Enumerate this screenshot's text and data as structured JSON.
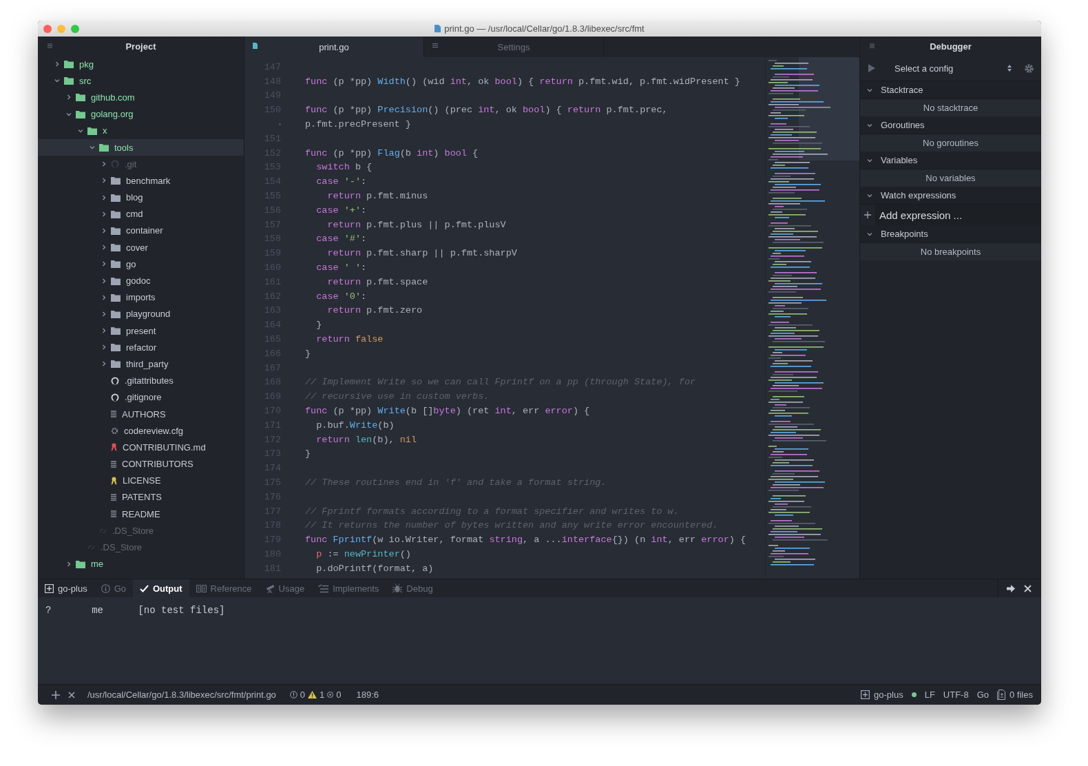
{
  "window": {
    "title": "print.go — /usr/local/Cellar/go/1.8.3/libexec/src/fmt"
  },
  "project": {
    "title": "Project",
    "tree": [
      {
        "name": "pkg",
        "kind": "folder",
        "color": "#73c990",
        "expanded": false,
        "selected": false,
        "dimmed": false
      },
      {
        "name": "src",
        "kind": "folder",
        "color": "#73c990",
        "expanded": true,
        "selected": false,
        "dimmed": false,
        "children": [
          {
            "name": "github.com",
            "kind": "folder",
            "color": "#73c990",
            "expanded": false,
            "selected": false,
            "dimmed": false
          },
          {
            "name": "golang.org",
            "kind": "folder",
            "color": "#73c990",
            "expanded": true,
            "selected": false,
            "dimmed": false,
            "children": [
              {
                "name": "x",
                "kind": "folder",
                "color": "#73c990",
                "expanded": true,
                "selected": false,
                "dimmed": false,
                "children": [
                  {
                    "name": "tools",
                    "kind": "folder",
                    "color": "#73c990",
                    "expanded": true,
                    "selected": true,
                    "dimmed": false,
                    "children": [
                      {
                        "name": ".git",
                        "kind": "repo",
                        "expanded": false,
                        "selected": false,
                        "dimmed": true
                      },
                      {
                        "name": "benchmark",
                        "kind": "folder",
                        "color": "#9da5b4",
                        "expanded": false,
                        "selected": false,
                        "dimmed": false
                      },
                      {
                        "name": "blog",
                        "kind": "folder",
                        "color": "#9da5b4",
                        "expanded": false,
                        "selected": false,
                        "dimmed": false
                      },
                      {
                        "name": "cmd",
                        "kind": "folder",
                        "color": "#9da5b4",
                        "expanded": false,
                        "selected": false,
                        "dimmed": false
                      },
                      {
                        "name": "container",
                        "kind": "folder",
                        "color": "#9da5b4",
                        "expanded": false,
                        "selected": false,
                        "dimmed": false
                      },
                      {
                        "name": "cover",
                        "kind": "folder",
                        "color": "#9da5b4",
                        "expanded": false,
                        "selected": false,
                        "dimmed": false
                      },
                      {
                        "name": "go",
                        "kind": "folder",
                        "color": "#9da5b4",
                        "expanded": false,
                        "selected": false,
                        "dimmed": false
                      },
                      {
                        "name": "godoc",
                        "kind": "folder",
                        "color": "#9da5b4",
                        "expanded": false,
                        "selected": false,
                        "dimmed": false
                      },
                      {
                        "name": "imports",
                        "kind": "folder",
                        "color": "#9da5b4",
                        "expanded": false,
                        "selected": false,
                        "dimmed": false
                      },
                      {
                        "name": "playground",
                        "kind": "folder",
                        "color": "#9da5b4",
                        "expanded": false,
                        "selected": false,
                        "dimmed": false
                      },
                      {
                        "name": "present",
                        "kind": "folder",
                        "color": "#9da5b4",
                        "expanded": false,
                        "selected": false,
                        "dimmed": false
                      },
                      {
                        "name": "refactor",
                        "kind": "folder",
                        "color": "#9da5b4",
                        "expanded": false,
                        "selected": false,
                        "dimmed": false
                      },
                      {
                        "name": "third_party",
                        "kind": "folder",
                        "color": "#9da5b4",
                        "expanded": false,
                        "selected": false,
                        "dimmed": false
                      },
                      {
                        "name": ".gitattributes",
                        "kind": "git",
                        "selected": false,
                        "dimmed": false
                      },
                      {
                        "name": ".gitignore",
                        "kind": "git",
                        "selected": false,
                        "dimmed": false
                      },
                      {
                        "name": "AUTHORS",
                        "kind": "text",
                        "selected": false,
                        "dimmed": false
                      },
                      {
                        "name": "codereview.cfg",
                        "kind": "config",
                        "selected": false,
                        "dimmed": false
                      },
                      {
                        "name": "CONTRIBUTING.md",
                        "kind": "markdown",
                        "selected": false,
                        "dimmed": false
                      },
                      {
                        "name": "CONTRIBUTORS",
                        "kind": "text",
                        "selected": false,
                        "dimmed": false
                      },
                      {
                        "name": "LICENSE",
                        "kind": "license",
                        "selected": false,
                        "dimmed": false
                      },
                      {
                        "name": "PATENTS",
                        "kind": "text",
                        "selected": false,
                        "dimmed": false
                      },
                      {
                        "name": "README",
                        "kind": "text",
                        "selected": false,
                        "dimmed": false
                      }
                    ]
                  },
                  {
                    "name": ".DS_Store",
                    "kind": "link",
                    "selected": false,
                    "dimmed": true
                  }
                ]
              },
              {
                "name": ".DS_Store",
                "kind": "link",
                "selected": false,
                "dimmed": true
              }
            ]
          },
          {
            "name": "me",
            "kind": "folder",
            "color": "#73c990",
            "expanded": false,
            "selected": false,
            "dimmed": false
          }
        ]
      }
    ]
  },
  "editor": {
    "tabs": [
      {
        "label": "print.go",
        "kind": "file",
        "selected": true
      },
      {
        "label": "Settings",
        "kind": "settings",
        "selected": false
      }
    ],
    "lines": [
      {
        "number": "147"
      },
      {
        "number": "148",
        "tokens": [
          {
            "kind": "kw",
            "text": "func"
          },
          {
            "kind": "plain",
            "text": " (p *pp) "
          },
          {
            "kind": "fn",
            "text": "Width"
          },
          {
            "kind": "plain",
            "text": "() (wid "
          },
          {
            "kind": "type",
            "text": "int"
          },
          {
            "kind": "plain",
            "text": ", ok "
          },
          {
            "kind": "type",
            "text": "bool"
          },
          {
            "kind": "plain",
            "text": ") { "
          },
          {
            "kind": "kw",
            "text": "return"
          },
          {
            "kind": "plain",
            "text": " p.fmt.wid, p.fmt.widPresent }"
          }
        ]
      },
      {
        "number": "149"
      },
      {
        "number": "150",
        "tokens": [
          {
            "kind": "kw",
            "text": "func"
          },
          {
            "kind": "plain",
            "text": " (p *pp) "
          },
          {
            "kind": "fn",
            "text": "Precision"
          },
          {
            "kind": "plain",
            "text": "() (prec "
          },
          {
            "kind": "type",
            "text": "int"
          },
          {
            "kind": "plain",
            "text": ", ok "
          },
          {
            "kind": "type",
            "text": "bool"
          },
          {
            "kind": "plain",
            "text": ") { "
          },
          {
            "kind": "kw",
            "text": "return"
          },
          {
            "kind": "plain",
            "text": " p.fmt.prec,"
          }
        ],
        "wrapped": "p.fmt.precPresent }"
      },
      {
        "number": "151"
      },
      {
        "number": "152",
        "tokens": [
          {
            "kind": "kw",
            "text": "func"
          },
          {
            "kind": "plain",
            "text": " (p *pp) "
          },
          {
            "kind": "fn",
            "text": "Flag"
          },
          {
            "kind": "plain",
            "text": "(b "
          },
          {
            "kind": "type",
            "text": "int"
          },
          {
            "kind": "plain",
            "text": ") "
          },
          {
            "kind": "type",
            "text": "bool"
          },
          {
            "kind": "plain",
            "text": " {"
          }
        ]
      },
      {
        "number": "153",
        "tokens": [
          {
            "kind": "kw",
            "text": "  switch"
          },
          {
            "kind": "plain",
            "text": " b {"
          }
        ]
      },
      {
        "number": "154",
        "tokens": [
          {
            "kind": "kw",
            "text": "  case "
          },
          {
            "kind": "str",
            "text": "'-'"
          },
          {
            "kind": "plain",
            "text": ":"
          }
        ]
      },
      {
        "number": "155",
        "tokens": [
          {
            "kind": "kw",
            "text": "    return"
          },
          {
            "kind": "plain",
            "text": " p.fmt.minus"
          }
        ]
      },
      {
        "number": "156",
        "tokens": [
          {
            "kind": "kw",
            "text": "  case "
          },
          {
            "kind": "str",
            "text": "'+'"
          },
          {
            "kind": "plain",
            "text": ":"
          }
        ]
      },
      {
        "number": "157",
        "tokens": [
          {
            "kind": "kw",
            "text": "    return"
          },
          {
            "kind": "plain",
            "text": " p.fmt.plus || p.fmt.plusV"
          }
        ]
      },
      {
        "number": "158",
        "tokens": [
          {
            "kind": "kw",
            "text": "  case "
          },
          {
            "kind": "str",
            "text": "'#'"
          },
          {
            "kind": "plain",
            "text": ":"
          }
        ]
      },
      {
        "number": "159",
        "tokens": [
          {
            "kind": "kw",
            "text": "    return"
          },
          {
            "kind": "plain",
            "text": " p.fmt.sharp || p.fmt.sharpV"
          }
        ]
      },
      {
        "number": "160",
        "tokens": [
          {
            "kind": "kw",
            "text": "  case "
          },
          {
            "kind": "str",
            "text": "' '"
          },
          {
            "kind": "plain",
            "text": ":"
          }
        ]
      },
      {
        "number": "161",
        "tokens": [
          {
            "kind": "kw",
            "text": "    return"
          },
          {
            "kind": "plain",
            "text": " p.fmt.space"
          }
        ]
      },
      {
        "number": "162",
        "tokens": [
          {
            "kind": "kw",
            "text": "  case "
          },
          {
            "kind": "str",
            "text": "'0'"
          },
          {
            "kind": "plain",
            "text": ":"
          }
        ]
      },
      {
        "number": "163",
        "tokens": [
          {
            "kind": "kw",
            "text": "    return"
          },
          {
            "kind": "plain",
            "text": " p.fmt.zero"
          }
        ]
      },
      {
        "number": "164",
        "tokens": [
          {
            "kind": "plain",
            "text": "  }"
          }
        ]
      },
      {
        "number": "165",
        "tokens": [
          {
            "kind": "kw",
            "text": "  return "
          },
          {
            "kind": "const",
            "text": "false"
          }
        ]
      },
      {
        "number": "166",
        "tokens": [
          {
            "kind": "plain",
            "text": "}"
          }
        ]
      },
      {
        "number": "167"
      },
      {
        "number": "168",
        "tokens": [
          {
            "kind": "com",
            "text": "// Implement Write so we can call Fprintf on a pp (through State), for"
          }
        ]
      },
      {
        "number": "169",
        "tokens": [
          {
            "kind": "com",
            "text": "// recursive use in custom verbs."
          }
        ]
      },
      {
        "number": "170",
        "tokens": [
          {
            "kind": "kw",
            "text": "func"
          },
          {
            "kind": "plain",
            "text": " (p *pp) "
          },
          {
            "kind": "fn",
            "text": "Write"
          },
          {
            "kind": "plain",
            "text": "(b []"
          },
          {
            "kind": "type",
            "text": "byte"
          },
          {
            "kind": "plain",
            "text": ") (ret "
          },
          {
            "kind": "type",
            "text": "int"
          },
          {
            "kind": "plain",
            "text": ", err "
          },
          {
            "kind": "type",
            "text": "error"
          },
          {
            "kind": "plain",
            "text": ") {"
          }
        ]
      },
      {
        "number": "171",
        "tokens": [
          {
            "kind": "plain",
            "text": "  p.buf."
          },
          {
            "kind": "fn",
            "text": "Write"
          },
          {
            "kind": "plain",
            "text": "(b)"
          }
        ]
      },
      {
        "number": "172",
        "tokens": [
          {
            "kind": "kw",
            "text": "  return "
          },
          {
            "kind": "builtin",
            "text": "len"
          },
          {
            "kind": "plain",
            "text": "(b), "
          },
          {
            "kind": "const",
            "text": "nil"
          }
        ]
      },
      {
        "number": "173",
        "tokens": [
          {
            "kind": "plain",
            "text": "}"
          }
        ]
      },
      {
        "number": "174"
      },
      {
        "number": "175",
        "tokens": [
          {
            "kind": "com",
            "text": "// These routines end in 'f' and take a format string."
          }
        ]
      },
      {
        "number": "176"
      },
      {
        "number": "177",
        "tokens": [
          {
            "kind": "com",
            "text": "// Fprintf formats according to a format specifier and writes to w."
          }
        ]
      },
      {
        "number": "178",
        "tokens": [
          {
            "kind": "com",
            "text": "// It returns the number of bytes written and any write error encountered."
          }
        ]
      },
      {
        "number": "179",
        "tokens": [
          {
            "kind": "kw",
            "text": "func "
          },
          {
            "kind": "fn",
            "text": "Fprintf"
          },
          {
            "kind": "plain",
            "text": "(w io.Writer, format "
          },
          {
            "kind": "type",
            "text": "string"
          },
          {
            "kind": "plain",
            "text": ", a ..."
          },
          {
            "kind": "type",
            "text": "interface"
          },
          {
            "kind": "plain",
            "text": "{}) (n "
          },
          {
            "kind": "type",
            "text": "int"
          },
          {
            "kind": "plain",
            "text": ", err "
          },
          {
            "kind": "type",
            "text": "error"
          },
          {
            "kind": "plain",
            "text": ") {"
          }
        ]
      },
      {
        "number": "180",
        "tokens": [
          {
            "kind": "var",
            "text": "  p"
          },
          {
            "kind": "plain",
            "text": " := "
          },
          {
            "kind": "builtin",
            "text": "newPrinter"
          },
          {
            "kind": "plain",
            "text": "()"
          }
        ]
      },
      {
        "number": "181",
        "tokens": [
          {
            "kind": "plain",
            "text": "  p.doPrintf(format, a)"
          }
        ]
      }
    ]
  },
  "debugger": {
    "title": "Debugger",
    "config_select": "Select a config",
    "sections": [
      {
        "title": "Stacktrace",
        "expanded": true,
        "kind": "message",
        "message": "No stacktrace"
      },
      {
        "title": "Goroutines",
        "expanded": true,
        "kind": "message",
        "message": "No goroutines"
      },
      {
        "title": "Variables",
        "expanded": true,
        "kind": "message",
        "message": "No variables"
      },
      {
        "title": "Watch expressions",
        "expanded": true,
        "kind": "input",
        "placeholder": "Add expression ..."
      },
      {
        "title": "Breakpoints",
        "expanded": true,
        "kind": "message",
        "message": "No breakpoints"
      }
    ]
  },
  "bottom_panel": {
    "tabs": [
      {
        "label": "go-plus",
        "kind": "package",
        "selected": false
      },
      {
        "label": "Go",
        "kind": "info",
        "selected": false
      },
      {
        "label": "Output",
        "kind": "check",
        "selected": true
      },
      {
        "label": "Reference",
        "kind": "book",
        "selected": false
      },
      {
        "label": "Usage",
        "kind": "telescope",
        "selected": false
      },
      {
        "label": "Implements",
        "kind": "checklist",
        "selected": false
      },
      {
        "label": "Debug",
        "kind": "bug",
        "selected": false
      }
    ],
    "output": "?       me      [no test files]"
  },
  "status_bar": {
    "path": "/usr/local/Cellar/go/1.8.3/libexec/src/fmt/print.go",
    "errors": "0",
    "warnings": "1",
    "infos": "0",
    "cursor": "189:6",
    "package": "go-plus",
    "line_ending": "LF",
    "encoding": "UTF-8",
    "grammar": "Go",
    "files": "0 files"
  }
}
